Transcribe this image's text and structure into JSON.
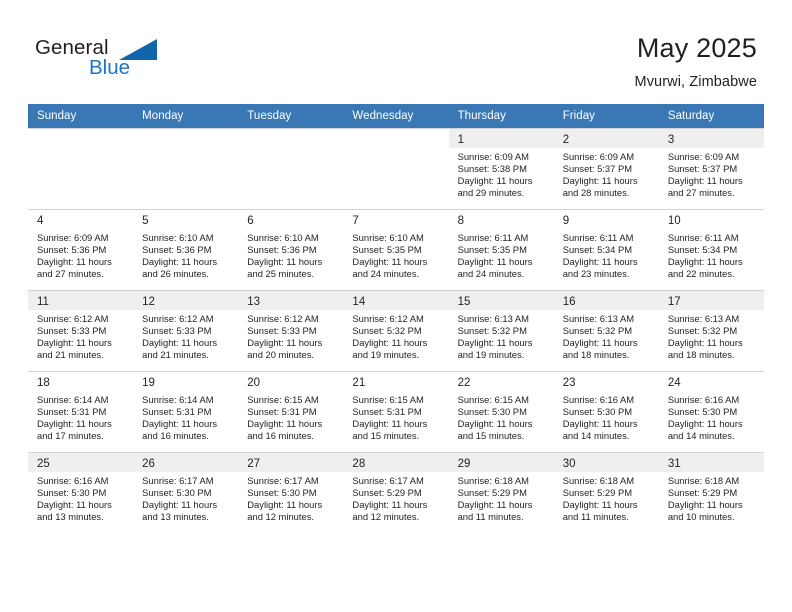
{
  "brand": {
    "name_part1": "General",
    "name_part2": "Blue",
    "triangle_color": "#1165AB",
    "blue_color": "#1A76C6"
  },
  "header": {
    "title": "May 2025",
    "subtitle": "Mvurwi, Zimbabwe"
  },
  "colors": {
    "header_row_bg": "#3A78B5",
    "header_row_text": "#FFFFFF",
    "alt_row_bg": "#EFEFEF",
    "grid_line": "#D3D3D3",
    "text": "#231F20"
  },
  "weekdays": [
    "Sunday",
    "Monday",
    "Tuesday",
    "Wednesday",
    "Thursday",
    "Friday",
    "Saturday"
  ],
  "weeks": [
    [
      {
        "day": "",
        "sunrise": "",
        "sunset": "",
        "daylight1": "",
        "daylight2": "",
        "empty": true
      },
      {
        "day": "",
        "sunrise": "",
        "sunset": "",
        "daylight1": "",
        "daylight2": "",
        "empty": true
      },
      {
        "day": "",
        "sunrise": "",
        "sunset": "",
        "daylight1": "",
        "daylight2": "",
        "empty": true
      },
      {
        "day": "",
        "sunrise": "",
        "sunset": "",
        "daylight1": "",
        "daylight2": "",
        "empty": true
      },
      {
        "day": "1",
        "sunrise": "Sunrise: 6:09 AM",
        "sunset": "Sunset: 5:38 PM",
        "daylight1": "Daylight: 11 hours",
        "daylight2": "and 29 minutes.",
        "empty": false
      },
      {
        "day": "2",
        "sunrise": "Sunrise: 6:09 AM",
        "sunset": "Sunset: 5:37 PM",
        "daylight1": "Daylight: 11 hours",
        "daylight2": "and 28 minutes.",
        "empty": false
      },
      {
        "day": "3",
        "sunrise": "Sunrise: 6:09 AM",
        "sunset": "Sunset: 5:37 PM",
        "daylight1": "Daylight: 11 hours",
        "daylight2": "and 27 minutes.",
        "empty": false
      }
    ],
    [
      {
        "day": "4",
        "sunrise": "Sunrise: 6:09 AM",
        "sunset": "Sunset: 5:36 PM",
        "daylight1": "Daylight: 11 hours",
        "daylight2": "and 27 minutes.",
        "empty": false
      },
      {
        "day": "5",
        "sunrise": "Sunrise: 6:10 AM",
        "sunset": "Sunset: 5:36 PM",
        "daylight1": "Daylight: 11 hours",
        "daylight2": "and 26 minutes.",
        "empty": false
      },
      {
        "day": "6",
        "sunrise": "Sunrise: 6:10 AM",
        "sunset": "Sunset: 5:36 PM",
        "daylight1": "Daylight: 11 hours",
        "daylight2": "and 25 minutes.",
        "empty": false
      },
      {
        "day": "7",
        "sunrise": "Sunrise: 6:10 AM",
        "sunset": "Sunset: 5:35 PM",
        "daylight1": "Daylight: 11 hours",
        "daylight2": "and 24 minutes.",
        "empty": false
      },
      {
        "day": "8",
        "sunrise": "Sunrise: 6:11 AM",
        "sunset": "Sunset: 5:35 PM",
        "daylight1": "Daylight: 11 hours",
        "daylight2": "and 24 minutes.",
        "empty": false
      },
      {
        "day": "9",
        "sunrise": "Sunrise: 6:11 AM",
        "sunset": "Sunset: 5:34 PM",
        "daylight1": "Daylight: 11 hours",
        "daylight2": "and 23 minutes.",
        "empty": false
      },
      {
        "day": "10",
        "sunrise": "Sunrise: 6:11 AM",
        "sunset": "Sunset: 5:34 PM",
        "daylight1": "Daylight: 11 hours",
        "daylight2": "and 22 minutes.",
        "empty": false
      }
    ],
    [
      {
        "day": "11",
        "sunrise": "Sunrise: 6:12 AM",
        "sunset": "Sunset: 5:33 PM",
        "daylight1": "Daylight: 11 hours",
        "daylight2": "and 21 minutes.",
        "empty": false
      },
      {
        "day": "12",
        "sunrise": "Sunrise: 6:12 AM",
        "sunset": "Sunset: 5:33 PM",
        "daylight1": "Daylight: 11 hours",
        "daylight2": "and 21 minutes.",
        "empty": false
      },
      {
        "day": "13",
        "sunrise": "Sunrise: 6:12 AM",
        "sunset": "Sunset: 5:33 PM",
        "daylight1": "Daylight: 11 hours",
        "daylight2": "and 20 minutes.",
        "empty": false
      },
      {
        "day": "14",
        "sunrise": "Sunrise: 6:12 AM",
        "sunset": "Sunset: 5:32 PM",
        "daylight1": "Daylight: 11 hours",
        "daylight2": "and 19 minutes.",
        "empty": false
      },
      {
        "day": "15",
        "sunrise": "Sunrise: 6:13 AM",
        "sunset": "Sunset: 5:32 PM",
        "daylight1": "Daylight: 11 hours",
        "daylight2": "and 19 minutes.",
        "empty": false
      },
      {
        "day": "16",
        "sunrise": "Sunrise: 6:13 AM",
        "sunset": "Sunset: 5:32 PM",
        "daylight1": "Daylight: 11 hours",
        "daylight2": "and 18 minutes.",
        "empty": false
      },
      {
        "day": "17",
        "sunrise": "Sunrise: 6:13 AM",
        "sunset": "Sunset: 5:32 PM",
        "daylight1": "Daylight: 11 hours",
        "daylight2": "and 18 minutes.",
        "empty": false
      }
    ],
    [
      {
        "day": "18",
        "sunrise": "Sunrise: 6:14 AM",
        "sunset": "Sunset: 5:31 PM",
        "daylight1": "Daylight: 11 hours",
        "daylight2": "and 17 minutes.",
        "empty": false
      },
      {
        "day": "19",
        "sunrise": "Sunrise: 6:14 AM",
        "sunset": "Sunset: 5:31 PM",
        "daylight1": "Daylight: 11 hours",
        "daylight2": "and 16 minutes.",
        "empty": false
      },
      {
        "day": "20",
        "sunrise": "Sunrise: 6:15 AM",
        "sunset": "Sunset: 5:31 PM",
        "daylight1": "Daylight: 11 hours",
        "daylight2": "and 16 minutes.",
        "empty": false
      },
      {
        "day": "21",
        "sunrise": "Sunrise: 6:15 AM",
        "sunset": "Sunset: 5:31 PM",
        "daylight1": "Daylight: 11 hours",
        "daylight2": "and 15 minutes.",
        "empty": false
      },
      {
        "day": "22",
        "sunrise": "Sunrise: 6:15 AM",
        "sunset": "Sunset: 5:30 PM",
        "daylight1": "Daylight: 11 hours",
        "daylight2": "and 15 minutes.",
        "empty": false
      },
      {
        "day": "23",
        "sunrise": "Sunrise: 6:16 AM",
        "sunset": "Sunset: 5:30 PM",
        "daylight1": "Daylight: 11 hours",
        "daylight2": "and 14 minutes.",
        "empty": false
      },
      {
        "day": "24",
        "sunrise": "Sunrise: 6:16 AM",
        "sunset": "Sunset: 5:30 PM",
        "daylight1": "Daylight: 11 hours",
        "daylight2": "and 14 minutes.",
        "empty": false
      }
    ],
    [
      {
        "day": "25",
        "sunrise": "Sunrise: 6:16 AM",
        "sunset": "Sunset: 5:30 PM",
        "daylight1": "Daylight: 11 hours",
        "daylight2": "and 13 minutes.",
        "empty": false
      },
      {
        "day": "26",
        "sunrise": "Sunrise: 6:17 AM",
        "sunset": "Sunset: 5:30 PM",
        "daylight1": "Daylight: 11 hours",
        "daylight2": "and 13 minutes.",
        "empty": false
      },
      {
        "day": "27",
        "sunrise": "Sunrise: 6:17 AM",
        "sunset": "Sunset: 5:30 PM",
        "daylight1": "Daylight: 11 hours",
        "daylight2": "and 12 minutes.",
        "empty": false
      },
      {
        "day": "28",
        "sunrise": "Sunrise: 6:17 AM",
        "sunset": "Sunset: 5:29 PM",
        "daylight1": "Daylight: 11 hours",
        "daylight2": "and 12 minutes.",
        "empty": false
      },
      {
        "day": "29",
        "sunrise": "Sunrise: 6:18 AM",
        "sunset": "Sunset: 5:29 PM",
        "daylight1": "Daylight: 11 hours",
        "daylight2": "and 11 minutes.",
        "empty": false
      },
      {
        "day": "30",
        "sunrise": "Sunrise: 6:18 AM",
        "sunset": "Sunset: 5:29 PM",
        "daylight1": "Daylight: 11 hours",
        "daylight2": "and 11 minutes.",
        "empty": false
      },
      {
        "day": "31",
        "sunrise": "Sunrise: 6:18 AM",
        "sunset": "Sunset: 5:29 PM",
        "daylight1": "Daylight: 11 hours",
        "daylight2": "and 10 minutes.",
        "empty": false
      }
    ]
  ]
}
